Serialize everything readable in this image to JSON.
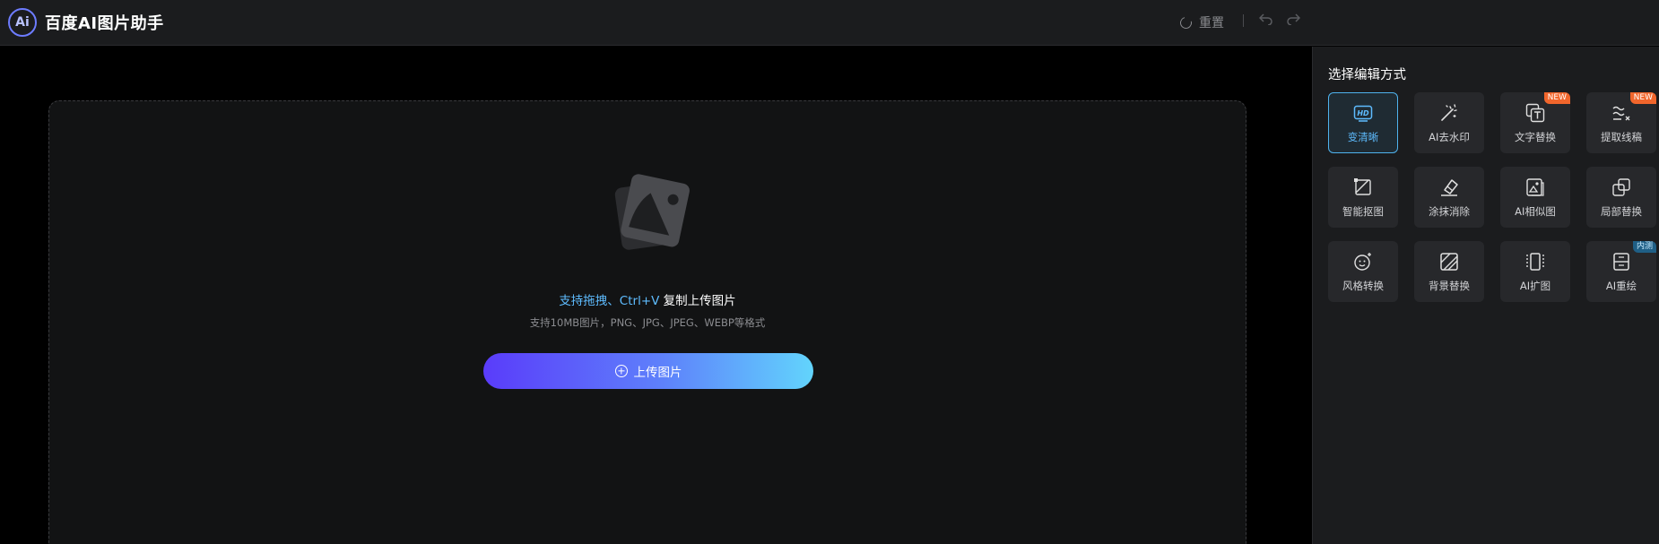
{
  "header": {
    "logo_text": "Ai",
    "app_title": "百度AI图片助手",
    "reset_label": "重置",
    "undo_icon": "undo-icon",
    "redo_icon": "redo-icon"
  },
  "dropzone": {
    "hint_accent": "支持拖拽、Ctrl+V",
    "hint_rest": " 复制上传图片",
    "format_hint": "支持10MB图片，PNG、JPG、JPEG、WEBP等格式",
    "upload_label": "上传图片",
    "upload_gradient": [
      "#5a3cfa",
      "#5e82fb",
      "#62d4fc"
    ]
  },
  "panel": {
    "title": "选择编辑方式",
    "tools": [
      {
        "label": "变清晰",
        "icon": "hd-icon",
        "badge": "",
        "active": true
      },
      {
        "label": "AI去水印",
        "icon": "magic-wand-icon",
        "badge": ""
      },
      {
        "label": "文字替换",
        "icon": "text-replace-icon",
        "badge": "NEW"
      },
      {
        "label": "提取线稿",
        "icon": "line-art-icon",
        "badge": "NEW"
      },
      {
        "label": "智能抠图",
        "icon": "cutout-icon",
        "badge": ""
      },
      {
        "label": "涂抹消除",
        "icon": "eraser-icon",
        "badge": ""
      },
      {
        "label": "AI相似图",
        "icon": "similar-image-icon",
        "badge": ""
      },
      {
        "label": "局部替换",
        "icon": "partial-replace-icon",
        "badge": ""
      },
      {
        "label": "风格转换",
        "icon": "style-icon",
        "badge": ""
      },
      {
        "label": "背景替换",
        "icon": "background-icon",
        "badge": ""
      },
      {
        "label": "AI扩图",
        "icon": "expand-icon",
        "badge": ""
      },
      {
        "label": "AI重绘",
        "icon": "redraw-icon",
        "badge": "内测"
      }
    ]
  },
  "colors": {
    "accent": "#5ebcff",
    "badge_new": "#f1662c",
    "badge_beta": "#1f5f86",
    "panel_bg": "#1b1c1e",
    "tile_bg": "#27282b"
  }
}
